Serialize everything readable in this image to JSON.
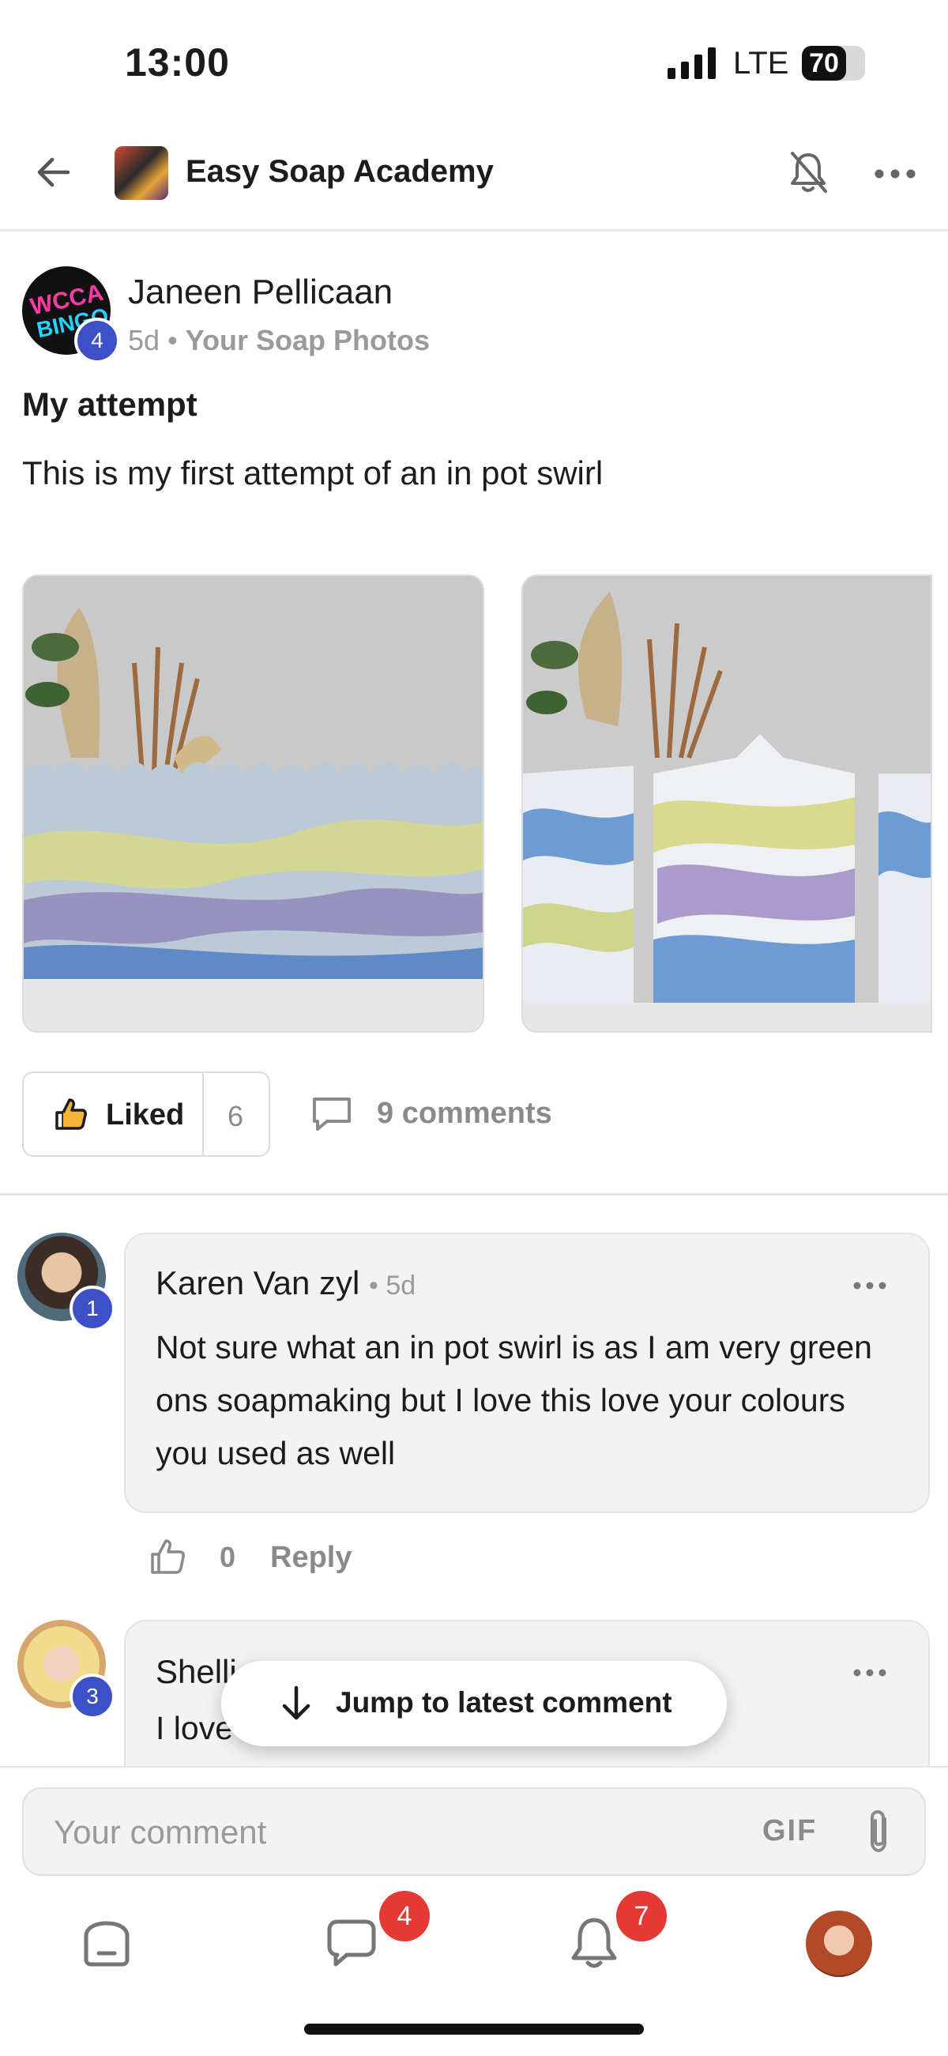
{
  "status_bar": {
    "time": "13:00",
    "network": "LTE",
    "battery": "70",
    "battery_level": 0.7
  },
  "header": {
    "group_name": "Easy Soap Academy"
  },
  "post": {
    "author": {
      "name": "Janeen Pellicaan",
      "badge": "4",
      "avatar_text_line1": "WCCA",
      "avatar_text_line2": "BINGO"
    },
    "age": "5d",
    "meta_separator": "•",
    "category": "Your Soap Photos",
    "title": "My attempt",
    "body": "This is my first attempt of an in pot swirl",
    "liked_label": "Liked",
    "like_count": "6",
    "comments_label": "9 comments"
  },
  "comments": [
    {
      "author": "Karen Van zyl",
      "time": "• 5d",
      "badge": "1",
      "text": "Not sure what an in pot swirl is as I am very green ons soapmaking but I love this love your colours you used as well",
      "like_count": "0",
      "reply_label": "Reply"
    },
    {
      "author": "Shelli",
      "badge": "3",
      "text": "I love"
    }
  ],
  "jump_button": {
    "label": "Jump to latest comment"
  },
  "composer": {
    "placeholder": "Your comment",
    "gif_label": "GIF"
  },
  "bottom_nav": {
    "chat_badge": "4",
    "notifications_badge": "7"
  }
}
